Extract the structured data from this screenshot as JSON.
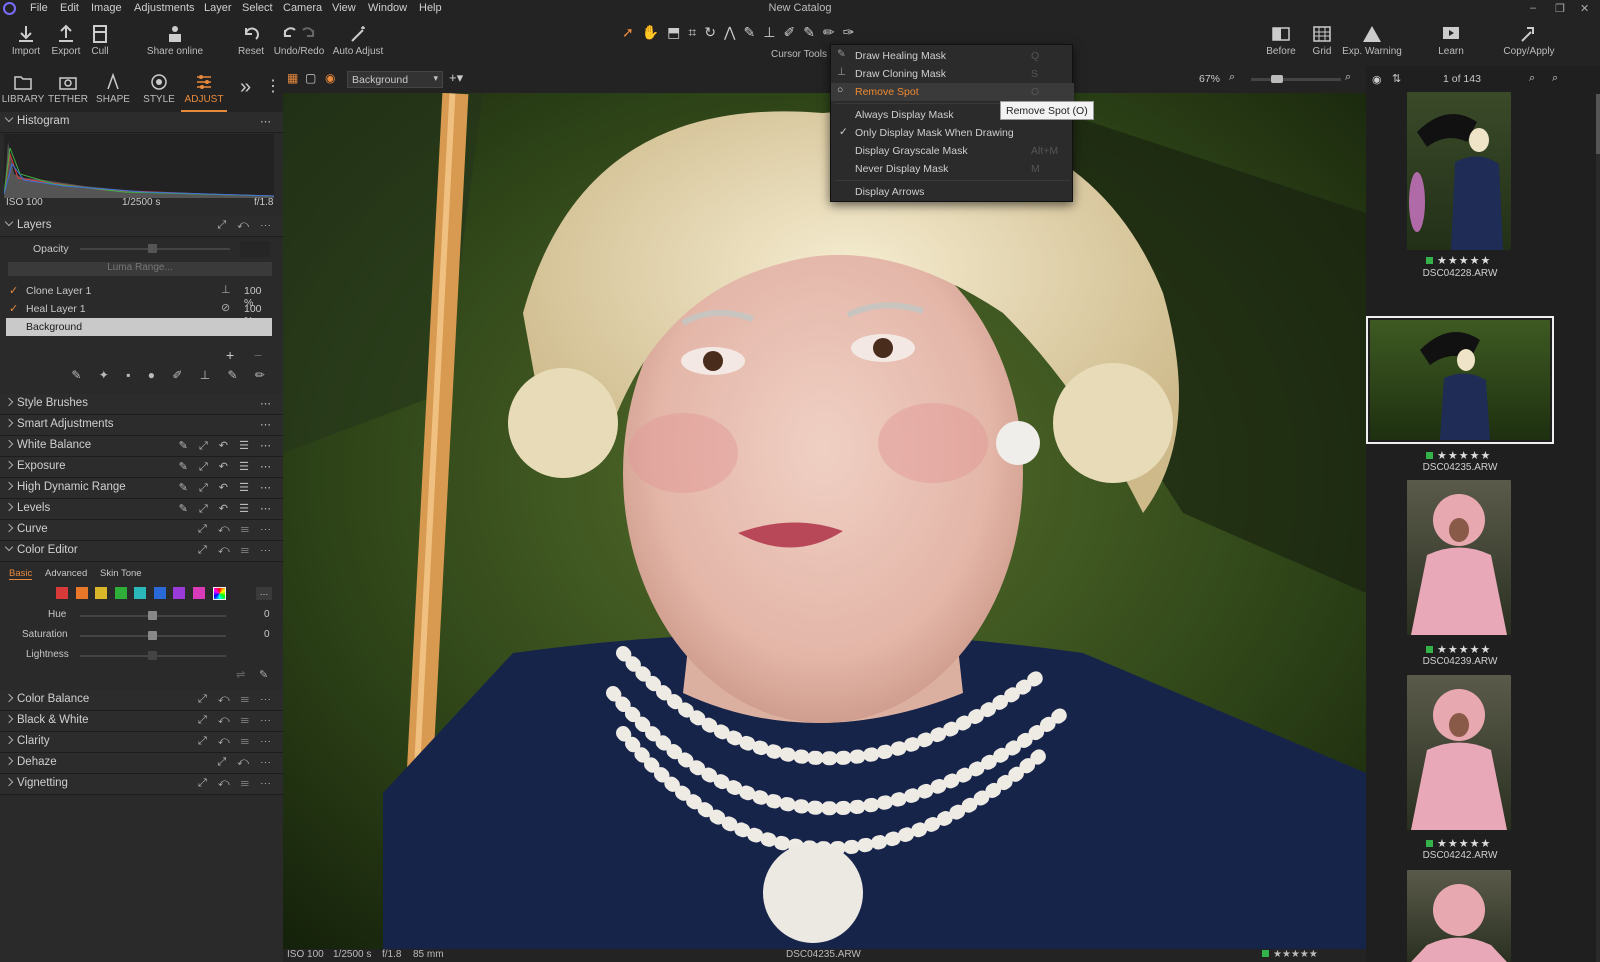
{
  "menu": {
    "items": [
      "File",
      "Edit",
      "Image",
      "Adjustments",
      "Layer",
      "Select",
      "Camera",
      "View",
      "Window",
      "Help"
    ],
    "window_title": "New Catalog"
  },
  "toolbar": {
    "import": "Import",
    "export": "Export",
    "cull": "Cull",
    "share": "Share online",
    "reset": "Reset",
    "undo_redo": "Undo/Redo",
    "auto_adjust": "Auto Adjust",
    "cursor_tools": "Cursor Tools",
    "before": "Before",
    "grid": "Grid",
    "exp_warning": "Exp. Warning",
    "learn": "Learn",
    "copy_apply": "Copy/Apply"
  },
  "tabs": [
    {
      "label": "LIBRARY"
    },
    {
      "label": "TETHER"
    },
    {
      "label": "SHAPE"
    },
    {
      "label": "STYLE"
    },
    {
      "label": "ADJUST"
    }
  ],
  "histogram": {
    "title": "Histogram",
    "iso": "ISO 100",
    "shutter": "1/2500 s",
    "aperture": "f/1.8"
  },
  "layers": {
    "title": "Layers",
    "opacity_label": "Opacity",
    "luma_range": "Luma Range...",
    "items": [
      {
        "name": "Clone Layer 1",
        "opacity": "100 %"
      },
      {
        "name": "Heal Layer 1",
        "opacity": "100 %"
      },
      {
        "name": "Background"
      }
    ]
  },
  "sections": {
    "style_brushes": "Style Brushes",
    "smart_adjustments": "Smart Adjustments",
    "white_balance": "White Balance",
    "exposure": "Exposure",
    "hdr": "High Dynamic Range",
    "levels": "Levels",
    "curve": "Curve",
    "color_editor": "Color Editor",
    "color_balance": "Color Balance",
    "black_white": "Black & White",
    "clarity": "Clarity",
    "dehaze": "Dehaze",
    "vignetting": "Vignetting"
  },
  "color_editor": {
    "tabs": [
      "Basic",
      "Advanced",
      "Skin Tone"
    ],
    "hue_label": "Hue",
    "hue_value": "0",
    "saturation_label": "Saturation",
    "saturation_value": "0",
    "lightness_label": "Lightness",
    "swatches": [
      "#d83a3a",
      "#e8772a",
      "#d8b82a",
      "#2fae3a",
      "#2ab8b8",
      "#2a6ad8",
      "#9a3ad8",
      "#d83ab8"
    ]
  },
  "viewer": {
    "layer_select": "Background",
    "zoom": "67%",
    "count": "1 of 143",
    "footer_iso": "ISO 100",
    "footer_shutter": "1/2500 s",
    "footer_aperture": "f/1.8",
    "footer_focal": "85 mm",
    "footer_file": "DSC04235.ARW"
  },
  "dropdown": {
    "items": [
      {
        "label": "Draw Healing Mask",
        "key": "Q"
      },
      {
        "label": "Draw Cloning Mask",
        "key": "S"
      },
      {
        "label": "Remove Spot",
        "key": "O"
      },
      {
        "label": "Always Display Mask",
        "key": ""
      },
      {
        "label": "Only Display Mask When Drawing",
        "key": ""
      },
      {
        "label": "Display Grayscale Mask",
        "key": "Alt+M"
      },
      {
        "label": "Never Display Mask",
        "key": "M"
      },
      {
        "label": "Display Arrows",
        "key": ""
      }
    ],
    "tooltip": "Remove Spot (O)"
  },
  "browser": {
    "thumbs": [
      {
        "name": "DSC04228.ARW",
        "stars": "★★★★★"
      },
      {
        "name": "DSC04235.ARW",
        "stars": "★★★★★"
      },
      {
        "name": "DSC04239.ARW",
        "stars": "★★★★★"
      },
      {
        "name": "DSC04242.ARW",
        "stars": "★★★★★"
      }
    ]
  },
  "colors": {
    "accent": "#e88a3c",
    "bg": "#1e1e1e",
    "panel": "#2a2a2a"
  }
}
